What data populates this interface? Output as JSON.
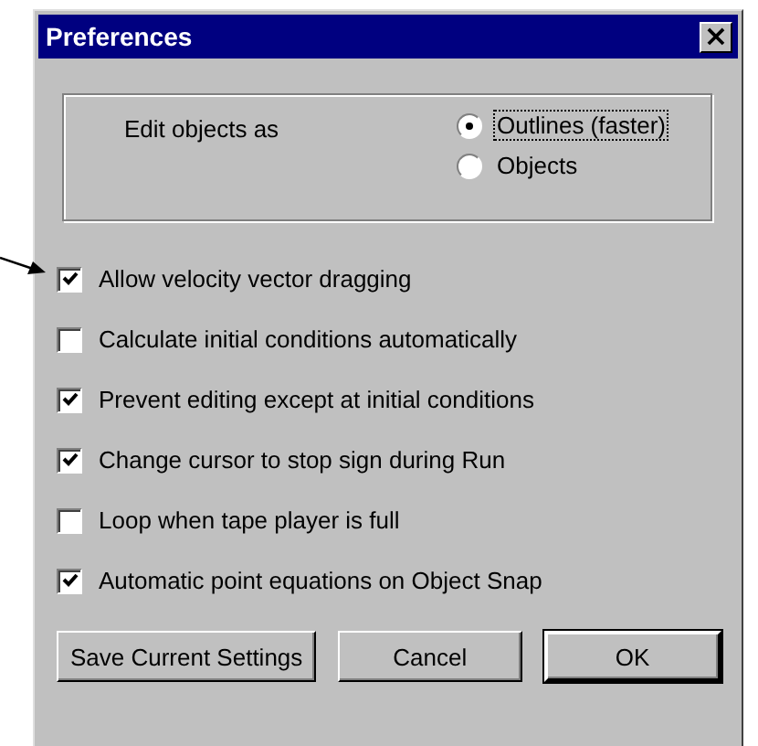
{
  "window": {
    "title": "Preferences",
    "close": "×"
  },
  "edit_mode": {
    "label": "Edit objects as",
    "options": [
      {
        "label": "Outlines (faster)",
        "selected": true
      },
      {
        "label": "Objects",
        "selected": false
      }
    ]
  },
  "options": [
    {
      "label": "Allow velocity vector dragging",
      "checked": true
    },
    {
      "label": "Calculate initial conditions automatically",
      "checked": false
    },
    {
      "label": "Prevent editing except at initial conditions",
      "checked": true
    },
    {
      "label": "Change cursor to stop sign during Run",
      "checked": true
    },
    {
      "label": "Loop when tape player is full",
      "checked": false
    },
    {
      "label": "Automatic point equations on Object Snap",
      "checked": true
    }
  ],
  "buttons": [
    {
      "label": "Save Current Settings",
      "default": false
    },
    {
      "label": "Cancel",
      "default": false
    },
    {
      "label": "OK",
      "default": true
    }
  ]
}
